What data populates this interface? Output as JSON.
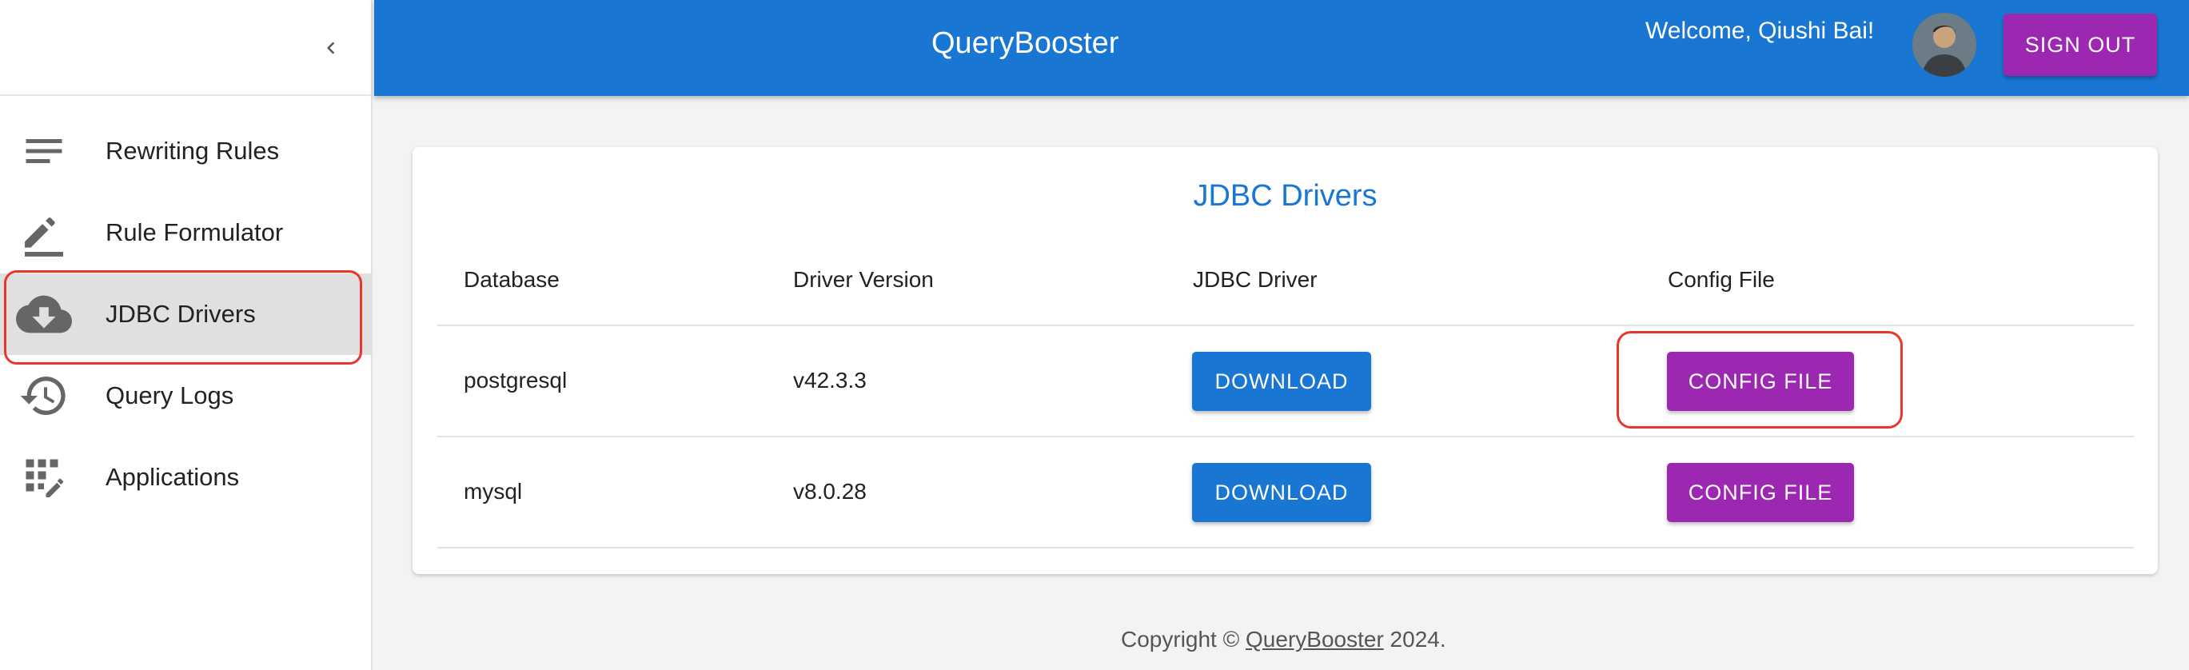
{
  "app": {
    "title": "QueryBooster"
  },
  "header": {
    "welcome": "Welcome, Qiushi Bai!",
    "signout_label": "SIGN OUT"
  },
  "sidebar": {
    "collapse_icon": "chevron-left-icon",
    "items": [
      {
        "label": "Rewriting Rules",
        "icon": "list-icon"
      },
      {
        "label": "Rule Formulator",
        "icon": "pencil-icon"
      },
      {
        "label": "JDBC Drivers",
        "icon": "cloud-download-icon",
        "active": true
      },
      {
        "label": "Query Logs",
        "icon": "history-icon"
      },
      {
        "label": "Applications",
        "icon": "app-grid-icon"
      }
    ]
  },
  "main": {
    "card_title": "JDBC Drivers",
    "columns": [
      "Database",
      "Driver Version",
      "JDBC Driver",
      "Config File"
    ],
    "rows": [
      {
        "database": "postgresql",
        "version": "v42.3.3",
        "download_label": "DOWNLOAD",
        "config_label": "CONFIG FILE"
      },
      {
        "database": "mysql",
        "version": "v8.0.28",
        "download_label": "DOWNLOAD",
        "config_label": "CONFIG FILE"
      }
    ]
  },
  "footer": {
    "prefix": "Copyright © ",
    "link": "QueryBooster",
    "suffix": " 2024."
  },
  "colors": {
    "primary": "#1976d2",
    "secondary": "#9c27b0",
    "highlight": "#e8372a"
  }
}
